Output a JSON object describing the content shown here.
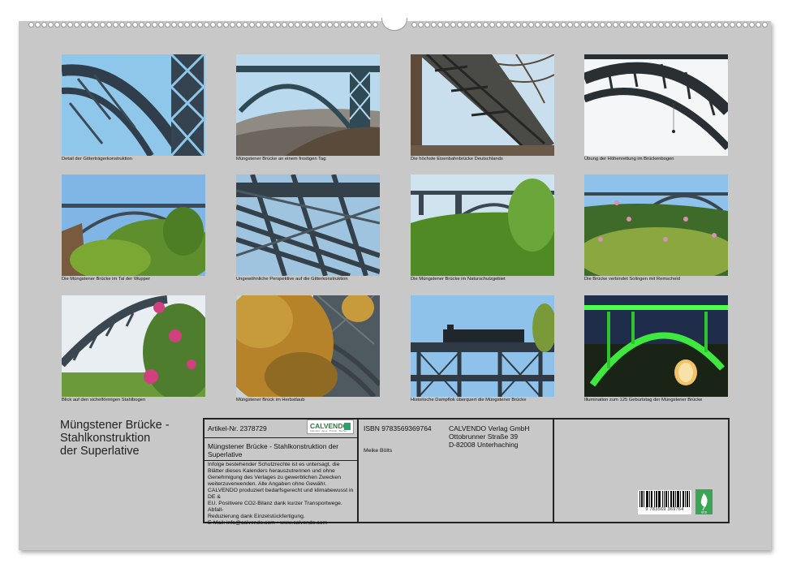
{
  "captions": [
    "Detail der Gitterträgerkonstruktion",
    "Müngstener Brücke an einem frostigen Tag",
    "Die höchste Eisenbahnbrücke Deutschlands",
    "Übung der Höhenrettung im Brückenbogen",
    "Die Müngstener Brücke im Tal der Wupper",
    "Ungewöhnliche Perspektive auf die Gitterkonstruktion",
    "Die Müngstener Brücke im Naturschutzgebiet",
    "Die Brücke verbindet Solingen mit Remscheid",
    "Blick auf den sichelförmigen Stahlbogen",
    "Müngstener Brück im Herbstlaub",
    "Historische Dampflok überquert die Müngstener Brücke",
    "Illumination zum 125 Geburtstag der Müngstener Brücke"
  ],
  "calendar": {
    "title_lines": [
      "Müngstener Brücke -",
      "Stahlkonstruktion",
      "der Superlative"
    ],
    "article": "Artikel-Nr. 2378729",
    "isbn": "ISBN 9783569369764",
    "publisher": [
      "CALVENDO Verlag GmbH",
      "Ottobrunner Straße 39",
      "D-82008 Unterhaching"
    ],
    "product_title": "Müngstener Brücke - Stahlkonstruktion der Superlative",
    "author": "Meike Bölts",
    "legal": [
      "Infolge bestehender Schutzrechte ist es untersagt, die",
      "Blätter dieses Kalenders herauszutrennen und ohne",
      "Genehmigung des Verlages zu gewerblichen Zwecken",
      "weiterzuverwenden. Alle Angaben ohne Gewähr.",
      "CALVENDO produziert bedarfsgerecht und klimabewusst in DE &",
      "EU. Positivere CO2-Bilanz dank kurzer Transportwege. Abfall-",
      "Reduzierung dank Einzelstückfertigung.",
      "E-Mail: info@calvendo.com • www.calvendo.com"
    ],
    "logo_text": "CALVENDO",
    "logo_sub": "Kalender · Apps · Puzzle · Bücher",
    "barcode_number": "9 783569 369764",
    "eco_label": "eco"
  }
}
